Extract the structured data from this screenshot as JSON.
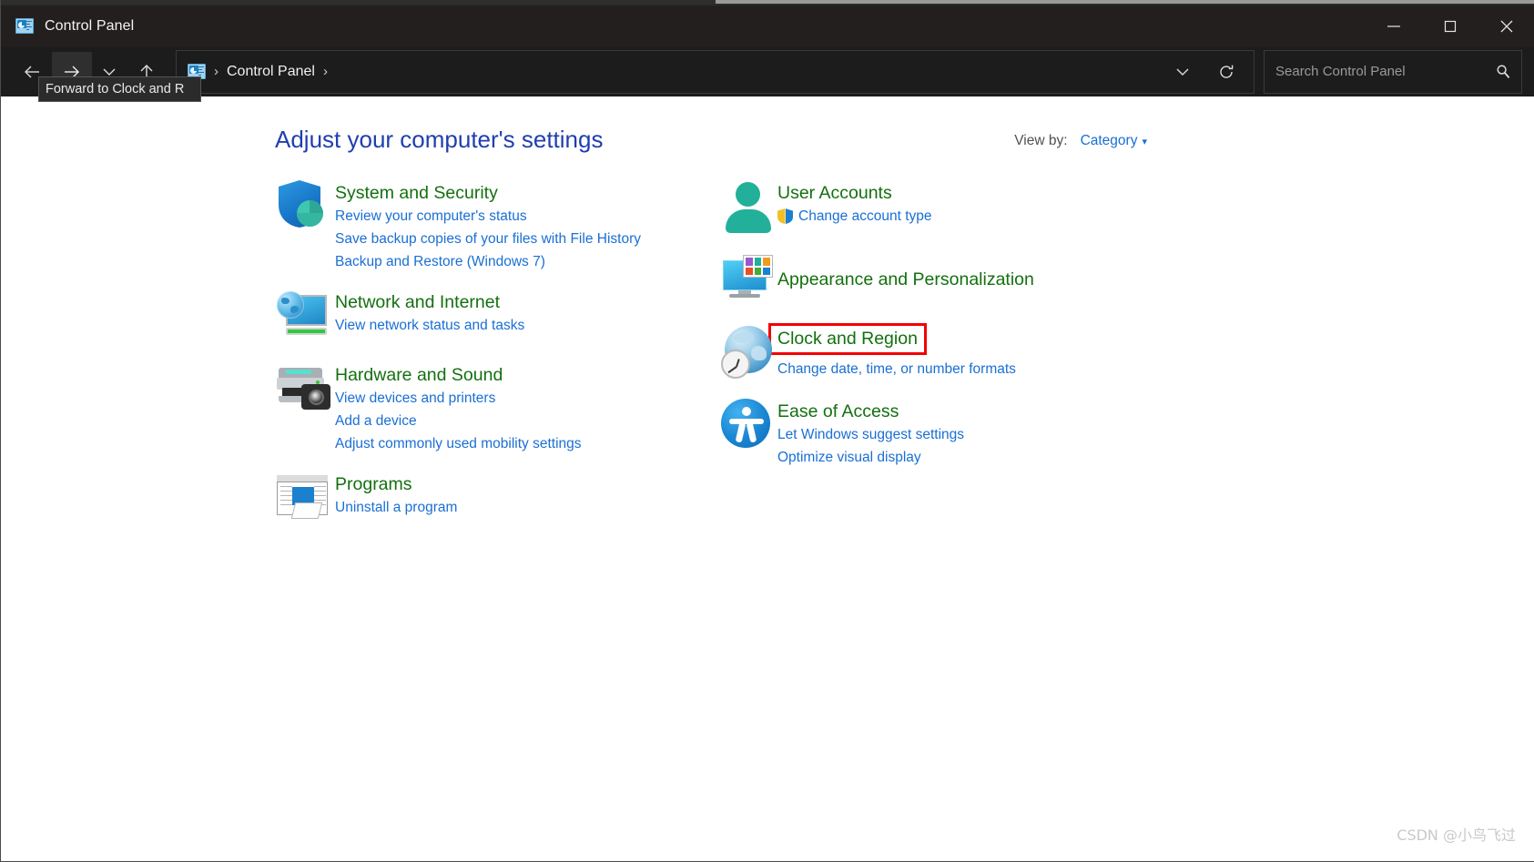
{
  "window": {
    "title": "Control Panel",
    "app_icon": "control-panel-icon",
    "caption": {
      "minimize": "minimize-icon",
      "maximize": "maximize-icon",
      "close": "close-icon"
    }
  },
  "toolbar": {
    "back": "back-arrow-icon",
    "forward": "forward-arrow-icon",
    "recent": "chevron-down-icon",
    "up": "up-arrow-icon",
    "breadcrumb": {
      "icon": "control-panel-icon",
      "sep1": "›",
      "item": "Control Panel",
      "sep2": "›"
    },
    "history_dropdown": "chevron-down-icon",
    "refresh": "refresh-icon"
  },
  "search": {
    "placeholder": "Search Control Panel",
    "value": "",
    "icon": "search-icon"
  },
  "tooltip": {
    "text": "Forward to Clock and R"
  },
  "main": {
    "page_title": "Adjust your computer's settings",
    "view_by": {
      "label": "View by:",
      "value": "Category",
      "caret": "▾"
    },
    "left_column": [
      {
        "icon": "system-and-security-icon",
        "title": "System and Security",
        "highlighted": false,
        "links": [
          {
            "text": "Review your computer's status",
            "shield": false
          },
          {
            "text": "Save backup copies of your files with File History",
            "shield": false
          },
          {
            "text": "Backup and Restore (Windows 7)",
            "shield": false
          }
        ]
      },
      {
        "icon": "network-and-internet-icon",
        "title": "Network and Internet",
        "highlighted": false,
        "links": [
          {
            "text": "View network status and tasks",
            "shield": false
          }
        ]
      },
      {
        "icon": "hardware-and-sound-icon",
        "title": "Hardware and Sound",
        "highlighted": false,
        "links": [
          {
            "text": "View devices and printers",
            "shield": false
          },
          {
            "text": "Add a device",
            "shield": false
          },
          {
            "text": "Adjust commonly used mobility settings",
            "shield": false
          }
        ]
      },
      {
        "icon": "programs-icon",
        "title": "Programs",
        "highlighted": false,
        "links": [
          {
            "text": "Uninstall a program",
            "shield": false
          }
        ]
      }
    ],
    "right_column": [
      {
        "icon": "user-accounts-icon",
        "title": "User Accounts",
        "highlighted": false,
        "links": [
          {
            "text": "Change account type",
            "shield": true
          }
        ]
      },
      {
        "icon": "appearance-and-personalization-icon",
        "title": "Appearance and Personalization",
        "highlighted": false,
        "links": []
      },
      {
        "icon": "clock-and-region-icon",
        "title": "Clock and Region",
        "highlighted": true,
        "links": [
          {
            "text": "Change date, time, or number formats",
            "shield": false
          }
        ]
      },
      {
        "icon": "ease-of-access-icon",
        "title": "Ease of Access",
        "highlighted": false,
        "links": [
          {
            "text": "Let Windows suggest settings",
            "shield": false
          },
          {
            "text": "Optimize visual display",
            "shield": false
          }
        ]
      }
    ]
  },
  "watermark": "CSDN @小鸟飞过",
  "colors": {
    "titlebar_bg": "#241f1f",
    "toolbar_bg": "#1c1c1c",
    "content_bg": "#ffffff",
    "page_title": "#1f3faf",
    "category_title": "#13700f",
    "link": "#1a6fd4",
    "highlight_box": "#f20000"
  }
}
